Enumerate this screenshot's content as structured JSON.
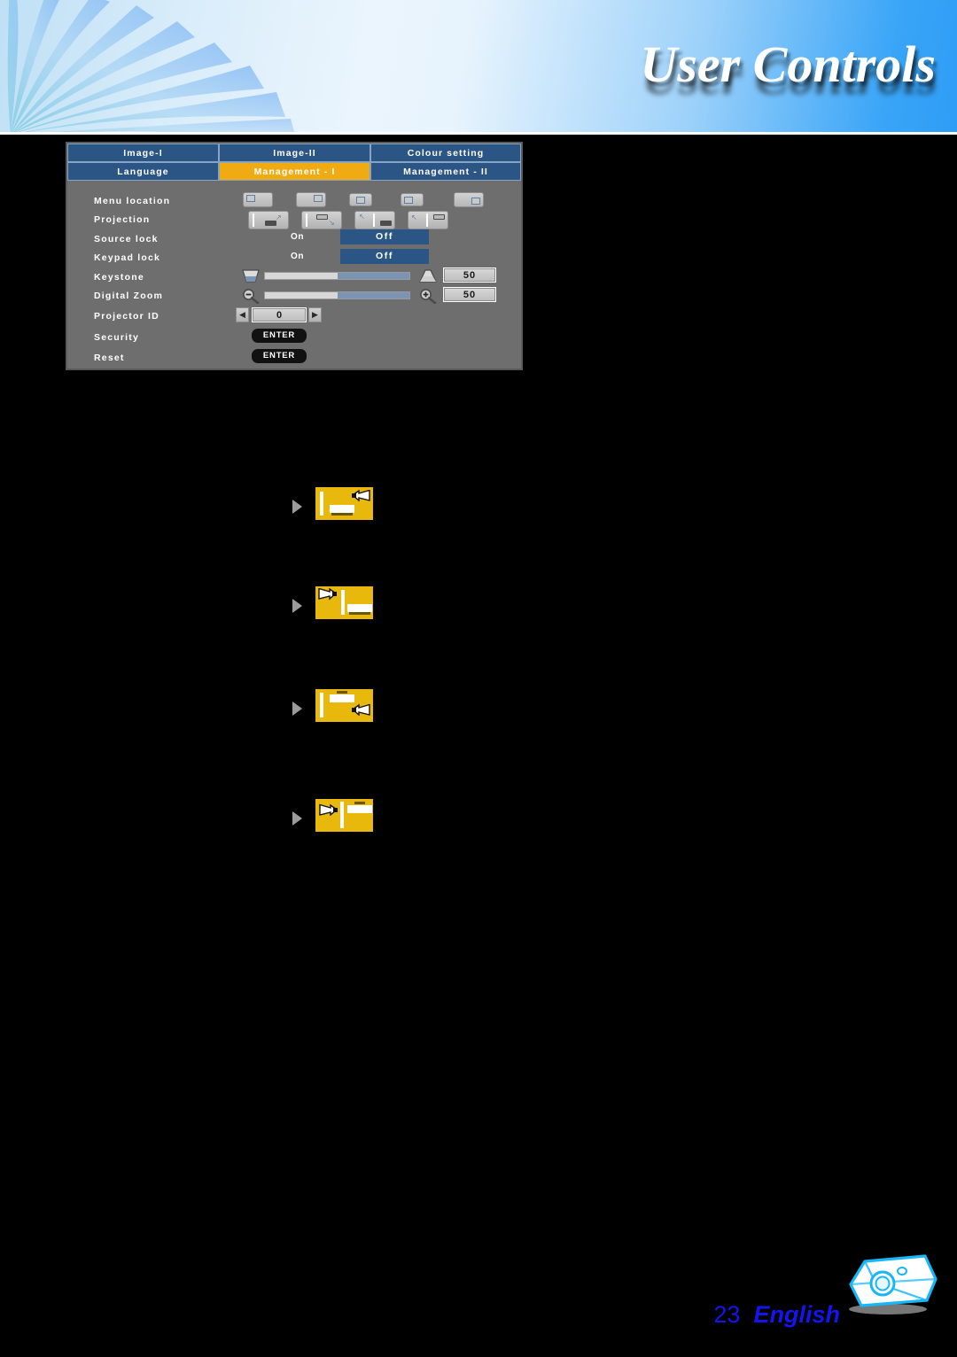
{
  "header": {
    "title": "User Controls",
    "decoration": "fan-leaf-pattern"
  },
  "osd": {
    "tabs_row1": [
      {
        "label": "Image-I",
        "active": false
      },
      {
        "label": "Image-II",
        "active": false
      },
      {
        "label": "Colour setting",
        "active": false
      }
    ],
    "tabs_row2": [
      {
        "label": "Language",
        "active": false
      },
      {
        "label": "Management - I",
        "active": true
      },
      {
        "label": "Management - II",
        "active": false
      }
    ],
    "rows": {
      "menu_location": {
        "label": "Menu location",
        "options": [
          "top-left",
          "top-right",
          "center",
          "bottom-left",
          "bottom-right"
        ]
      },
      "projection": {
        "label": "Projection",
        "options": [
          "front-desktop",
          "rear-desktop",
          "front-ceiling",
          "rear-ceiling"
        ]
      },
      "source_lock": {
        "label": "Source lock",
        "on_label": "On",
        "off_label": "Off",
        "selected": "Off"
      },
      "keypad_lock": {
        "label": "Keypad lock",
        "on_label": "On",
        "off_label": "Off",
        "selected": "Off"
      },
      "keystone": {
        "label": "Keystone",
        "value": "50",
        "min_icon": "keystone-wide-icon",
        "max_icon": "keystone-narrow-icon",
        "fill_percent": 50
      },
      "digital_zoom": {
        "label": "Digital Zoom",
        "value": "50",
        "min_icon": "zoom-out-icon",
        "max_icon": "zoom-in-icon",
        "fill_percent": 50
      },
      "projector_id": {
        "label": "Projector ID",
        "value": "0",
        "left_arrow": "◀",
        "right_arrow": "▶"
      },
      "security": {
        "label": "Security",
        "button_label": "ENTER"
      },
      "reset": {
        "label": "Reset",
        "button_label": "ENTER"
      }
    },
    "colors": {
      "tab_normal_bg": "#2b5584",
      "tab_active_bg": "#f0ab13",
      "panel_bg": "#6e6e6e",
      "toggle_selected_bg": "#2b5584",
      "slider_fill": "#7b94b4"
    }
  },
  "projection_modes": [
    {
      "id": "front-desktop",
      "icon": "projector-front-desktop-icon"
    },
    {
      "id": "rear-desktop",
      "icon": "projector-rear-desktop-icon"
    },
    {
      "id": "front-ceiling",
      "icon": "projector-front-ceiling-icon"
    },
    {
      "id": "rear-ceiling",
      "icon": "projector-rear-ceiling-icon"
    }
  ],
  "footer": {
    "page_number": "23",
    "language": "English",
    "logo_icon": "projector-outline-icon",
    "text_color": "#1414f0"
  }
}
